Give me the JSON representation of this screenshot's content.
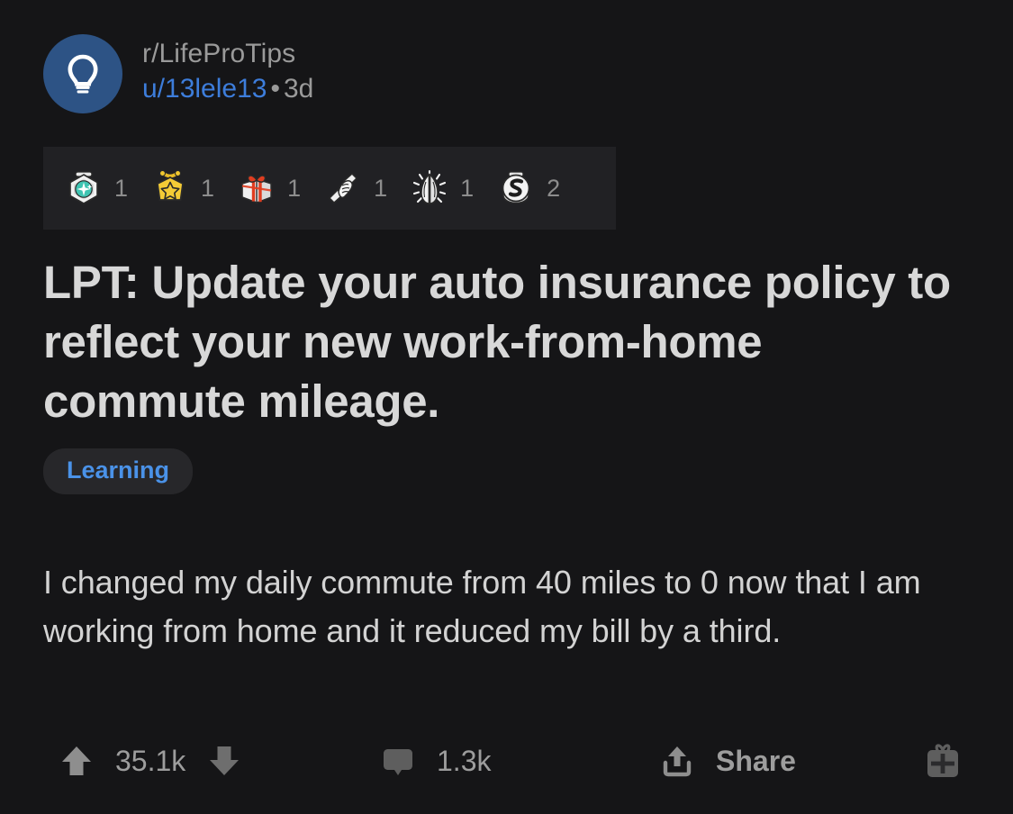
{
  "post": {
    "subreddit": "r/LifeProTips",
    "author": "u/13lele13",
    "separator": "•",
    "age": "3d",
    "avatar_icon": "lightbulb-icon",
    "avatar_color": "#2d5385",
    "title": "LPT: Update your auto insurance policy to reflect your new work-from-home commute mileage.",
    "flair": "Learning",
    "flair_color": "#4a92e8",
    "body": "I changed my daily commute from 40 miles to 0 now that I am working from home and it reduced my bill by a third."
  },
  "awards": [
    {
      "icon": "gem-award-icon",
      "name": "Gem",
      "count": "1"
    },
    {
      "icon": "gold-star-award-icon",
      "name": "Gold Star",
      "count": "1"
    },
    {
      "icon": "gift-box-award-icon",
      "name": "Gift",
      "count": "1"
    },
    {
      "icon": "helpful-handshake-award-icon",
      "name": "Helpful",
      "count": "1"
    },
    {
      "icon": "praying-hands-award-icon",
      "name": "Wholesome",
      "count": "1"
    },
    {
      "icon": "silver-award-icon",
      "name": "Silver",
      "count": "2"
    }
  ],
  "actions": {
    "upvote_icon": "upvote-arrow-icon",
    "downvote_icon": "downvote-arrow-icon",
    "vote_count": "35.1k",
    "comment_icon": "comment-bubble-icon",
    "comment_count": "1.3k",
    "share_icon": "share-icon",
    "share_label": "Share",
    "award_icon": "gift-icon"
  },
  "colors": {
    "background": "#151517",
    "awards_bar": "#212124",
    "title_text": "#d8d8d8",
    "muted_text": "#9a9a9a",
    "link_blue": "#3d7ddb"
  }
}
